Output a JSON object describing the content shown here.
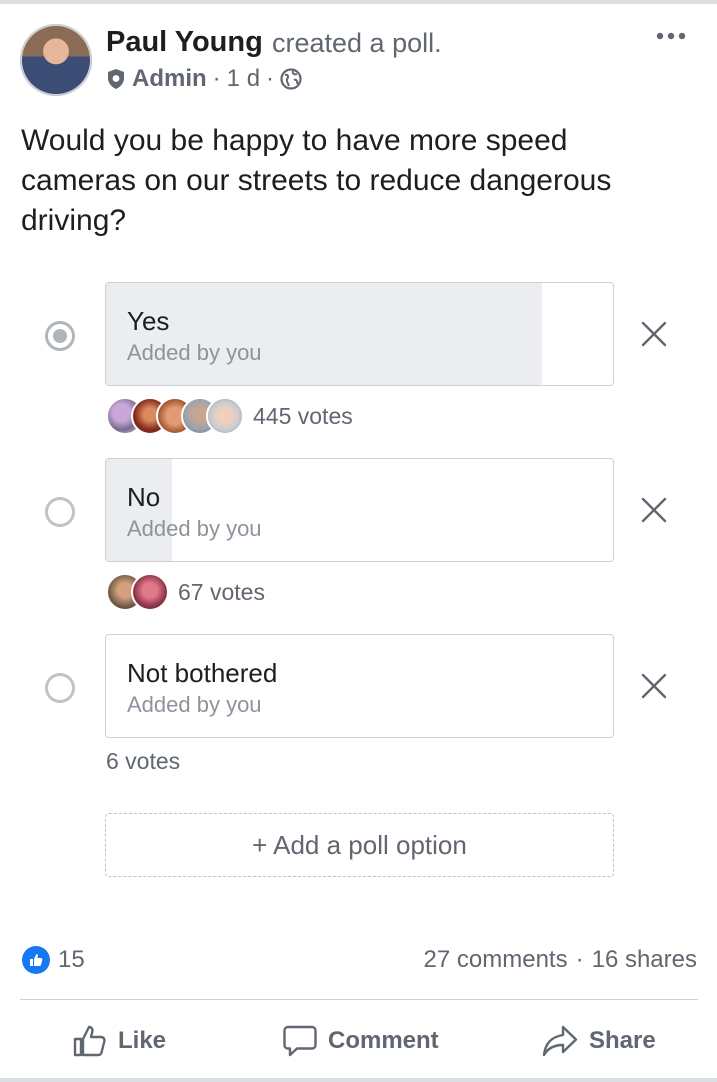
{
  "post": {
    "author": "Paul Young",
    "action": "created a poll.",
    "role": "Admin",
    "time": "1 d",
    "separator": "·",
    "question": "Would you be happy to have more speed cameras on our streets to reduce dangerous driving?"
  },
  "poll": {
    "options": [
      {
        "label": "Yes",
        "added_by": "Added by you",
        "votes_text": "445 votes",
        "selected": true,
        "share": 0.86
      },
      {
        "label": "No",
        "added_by": "Added by you",
        "votes_text": "67 votes",
        "selected": false,
        "share": 0.13
      },
      {
        "label": "Not bothered",
        "added_by": "Added by you",
        "votes_text": "6 votes",
        "selected": false,
        "share": 0.0
      }
    ],
    "add_option_label": "+ Add a poll option"
  },
  "footer": {
    "reactions_count": "15",
    "comments": "27 comments",
    "dot": "·",
    "shares": "16 shares"
  },
  "actions": {
    "like": "Like",
    "comment": "Comment",
    "share": "Share"
  },
  "colors": {
    "brand": "#1877f2",
    "fill": "#ebedf0"
  }
}
